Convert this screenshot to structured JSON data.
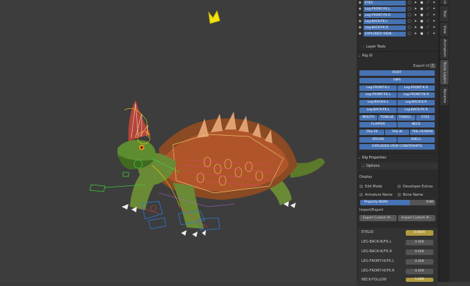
{
  "layers": [
    {
      "name": "EYES"
    },
    {
      "name": "Leg-FRONT-FK.L"
    },
    {
      "name": "Leg-FRONT-FK.R"
    },
    {
      "name": "Leg-BACK-FK.L"
    },
    {
      "name": "Leg-BACK-FK.R"
    },
    {
      "name": "EXPLODED VIEW..."
    }
  ],
  "sections": {
    "layer_tools": "Layer Tools",
    "rig_ui": "Rig UI",
    "rig_properties": "Rig Properties",
    "options": "Options"
  },
  "rig_ui": {
    "export_ui": "Export UI",
    "root": "ROOT",
    "hips": "HIPS",
    "pairs": [
      [
        "Leg-FRONT-K.L",
        "Leg-FRONT-K.R"
      ],
      [
        "Leg-FRONT-FK.L",
        "Leg-FRONT-FK.R"
      ],
      [
        "Leg-BACK-K.L",
        "Leg-BACK-K.R"
      ],
      [
        "Leg-BACK-FK.L",
        "Leg-BACK-FK.R"
      ]
    ],
    "row_a": [
      "MOUTH",
      "TONGUE",
      "TONGU...",
      "EYES"
    ],
    "row_b": [
      "FLAPPER",
      "NECK"
    ],
    "row_c": [
      "TAIL-FK",
      "TAIL-IK",
      "TAIL-FK-MAIN"
    ],
    "row_d": [
      "ORGAN",
      "SHELL"
    ],
    "exploded": "EXPLODED VIEW CONSTRAINTS"
  },
  "options": {
    "display": "Display",
    "edit_mode": "Edit Mode",
    "developer_extras": "Developer Extras",
    "armature_name": "Armature Name",
    "bone_name": "Bone Name",
    "property_width_label": "Property Width",
    "property_width_value": "0.60",
    "property_width_fraction": 0.66,
    "import_export": "Import/Export",
    "export_custom": "Export Custom Pr...",
    "import_custom": "Import Custom Pr..."
  },
  "properties": [
    {
      "name": "EYELID",
      "value": "0.0000",
      "highlight": true
    },
    {
      "name": "LEG-BACK-IK/FK.L",
      "value": "0.000",
      "highlight": false
    },
    {
      "name": "LEG-BACK-IK/FK.R",
      "value": "0.000",
      "highlight": false
    },
    {
      "name": "LEG-FRONT-IK/FK.L",
      "value": "0.000",
      "highlight": false
    },
    {
      "name": "LEG-FRONT-IK/FK.R",
      "value": "0.000",
      "highlight": false
    },
    {
      "name": "NECK-FOLLOW",
      "value": "1.000",
      "highlight": true
    }
  ],
  "tabs": [
    {
      "label": "Tool"
    },
    {
      "label": "View"
    },
    {
      "label": "Animation"
    },
    {
      "label": "Bone Layers"
    },
    {
      "label": "Rename"
    }
  ],
  "colors": {
    "accent": "#4772b3",
    "highlight": "#b29b3f"
  }
}
